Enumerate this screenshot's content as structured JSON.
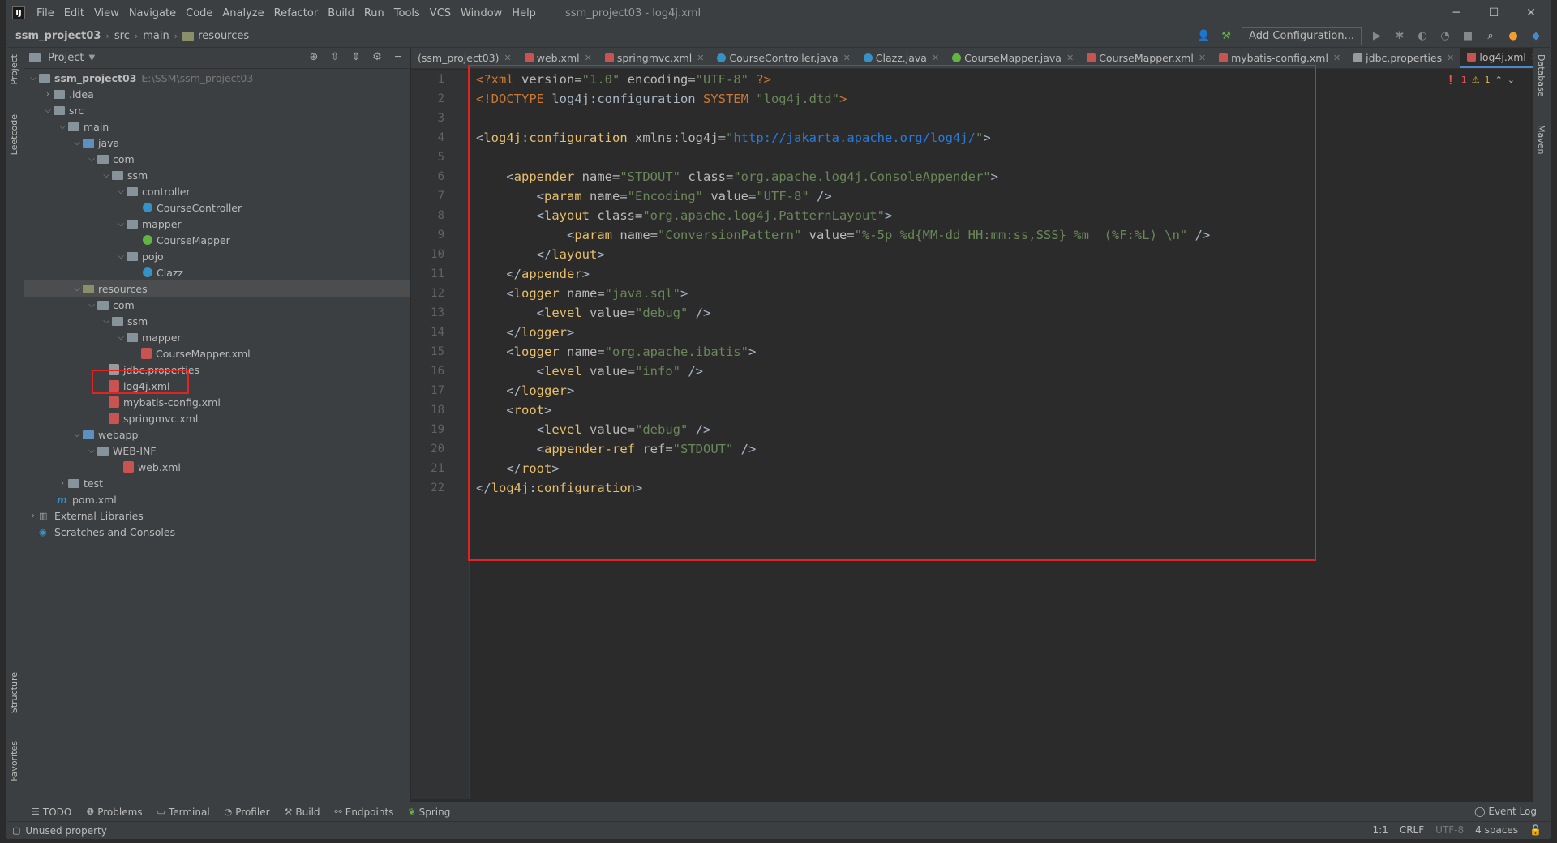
{
  "app": {
    "icon_text": "IJ",
    "menu": [
      "File",
      "Edit",
      "View",
      "Navigate",
      "Code",
      "Analyze",
      "Refactor",
      "Build",
      "Run",
      "Tools",
      "VCS",
      "Window",
      "Help"
    ],
    "window_title": "ssm_project03 - log4j.xml",
    "controls": {
      "minimize": "─",
      "maximize": "☐",
      "close": "✕"
    }
  },
  "navbar": {
    "breadcrumbs": [
      "ssm_project03",
      "src",
      "main",
      "resources"
    ],
    "add_configuration": "Add Configuration..."
  },
  "left_strip": {
    "project": "Project",
    "leetcode": "Leetcode",
    "structure": "Structure",
    "favorites": "Favorites"
  },
  "right_strip": {
    "database": "Database",
    "maven": "Maven"
  },
  "project_panel": {
    "title": "Project",
    "tree": [
      {
        "label": "ssm_project03",
        "path": "E:\\SSM\\ssm_project03"
      },
      {
        "label": ".idea"
      },
      {
        "label": "src"
      },
      {
        "label": "main"
      },
      {
        "label": "java"
      },
      {
        "label": "com"
      },
      {
        "label": "ssm"
      },
      {
        "label": "controller"
      },
      {
        "label": "CourseController"
      },
      {
        "label": "mapper"
      },
      {
        "label": "CourseMapper"
      },
      {
        "label": "pojo"
      },
      {
        "label": "Clazz"
      },
      {
        "label": "resources"
      },
      {
        "label": "com"
      },
      {
        "label": "ssm"
      },
      {
        "label": "mapper"
      },
      {
        "label": "CourseMapper.xml"
      },
      {
        "label": "jdbc.properties"
      },
      {
        "label": "log4j.xml"
      },
      {
        "label": "mybatis-config.xml"
      },
      {
        "label": "springmvc.xml"
      },
      {
        "label": "webapp"
      },
      {
        "label": "WEB-INF"
      },
      {
        "label": "web.xml"
      },
      {
        "label": "test"
      },
      {
        "label": "pom.xml"
      },
      {
        "label": "External Libraries"
      },
      {
        "label": "Scratches and Consoles"
      }
    ]
  },
  "tabs": [
    {
      "label": "(ssm_project03)"
    },
    {
      "label": "web.xml"
    },
    {
      "label": "springmvc.xml"
    },
    {
      "label": "CourseController.java"
    },
    {
      "label": "Clazz.java"
    },
    {
      "label": "CourseMapper.java"
    },
    {
      "label": "CourseMapper.xml"
    },
    {
      "label": "mybatis-config.xml"
    },
    {
      "label": "jdbc.properties"
    },
    {
      "label": "log4j.xml"
    }
  ],
  "editor": {
    "inspection": {
      "errors": "1",
      "warnings": "1"
    },
    "line_numbers": [
      "1",
      "2",
      "3",
      "4",
      "5",
      "6",
      "7",
      "8",
      "9",
      "10",
      "11",
      "12",
      "13",
      "14",
      "15",
      "16",
      "17",
      "18",
      "19",
      "20",
      "21",
      "22"
    ]
  },
  "bottom_tools": [
    "TODO",
    "Problems",
    "Terminal",
    "Profiler",
    "Build",
    "Endpoints",
    "Spring"
  ],
  "event_log": "Event Log",
  "status": {
    "message": "Unused property",
    "position": "1:1",
    "line_sep": "CRLF",
    "encoding": "UTF-8",
    "indent": "4 spaces"
  },
  "colors": {
    "accent": "#4a88c7",
    "highlight_box": "#e02424",
    "tag": "#e8bf6a",
    "value": "#6a8759"
  }
}
